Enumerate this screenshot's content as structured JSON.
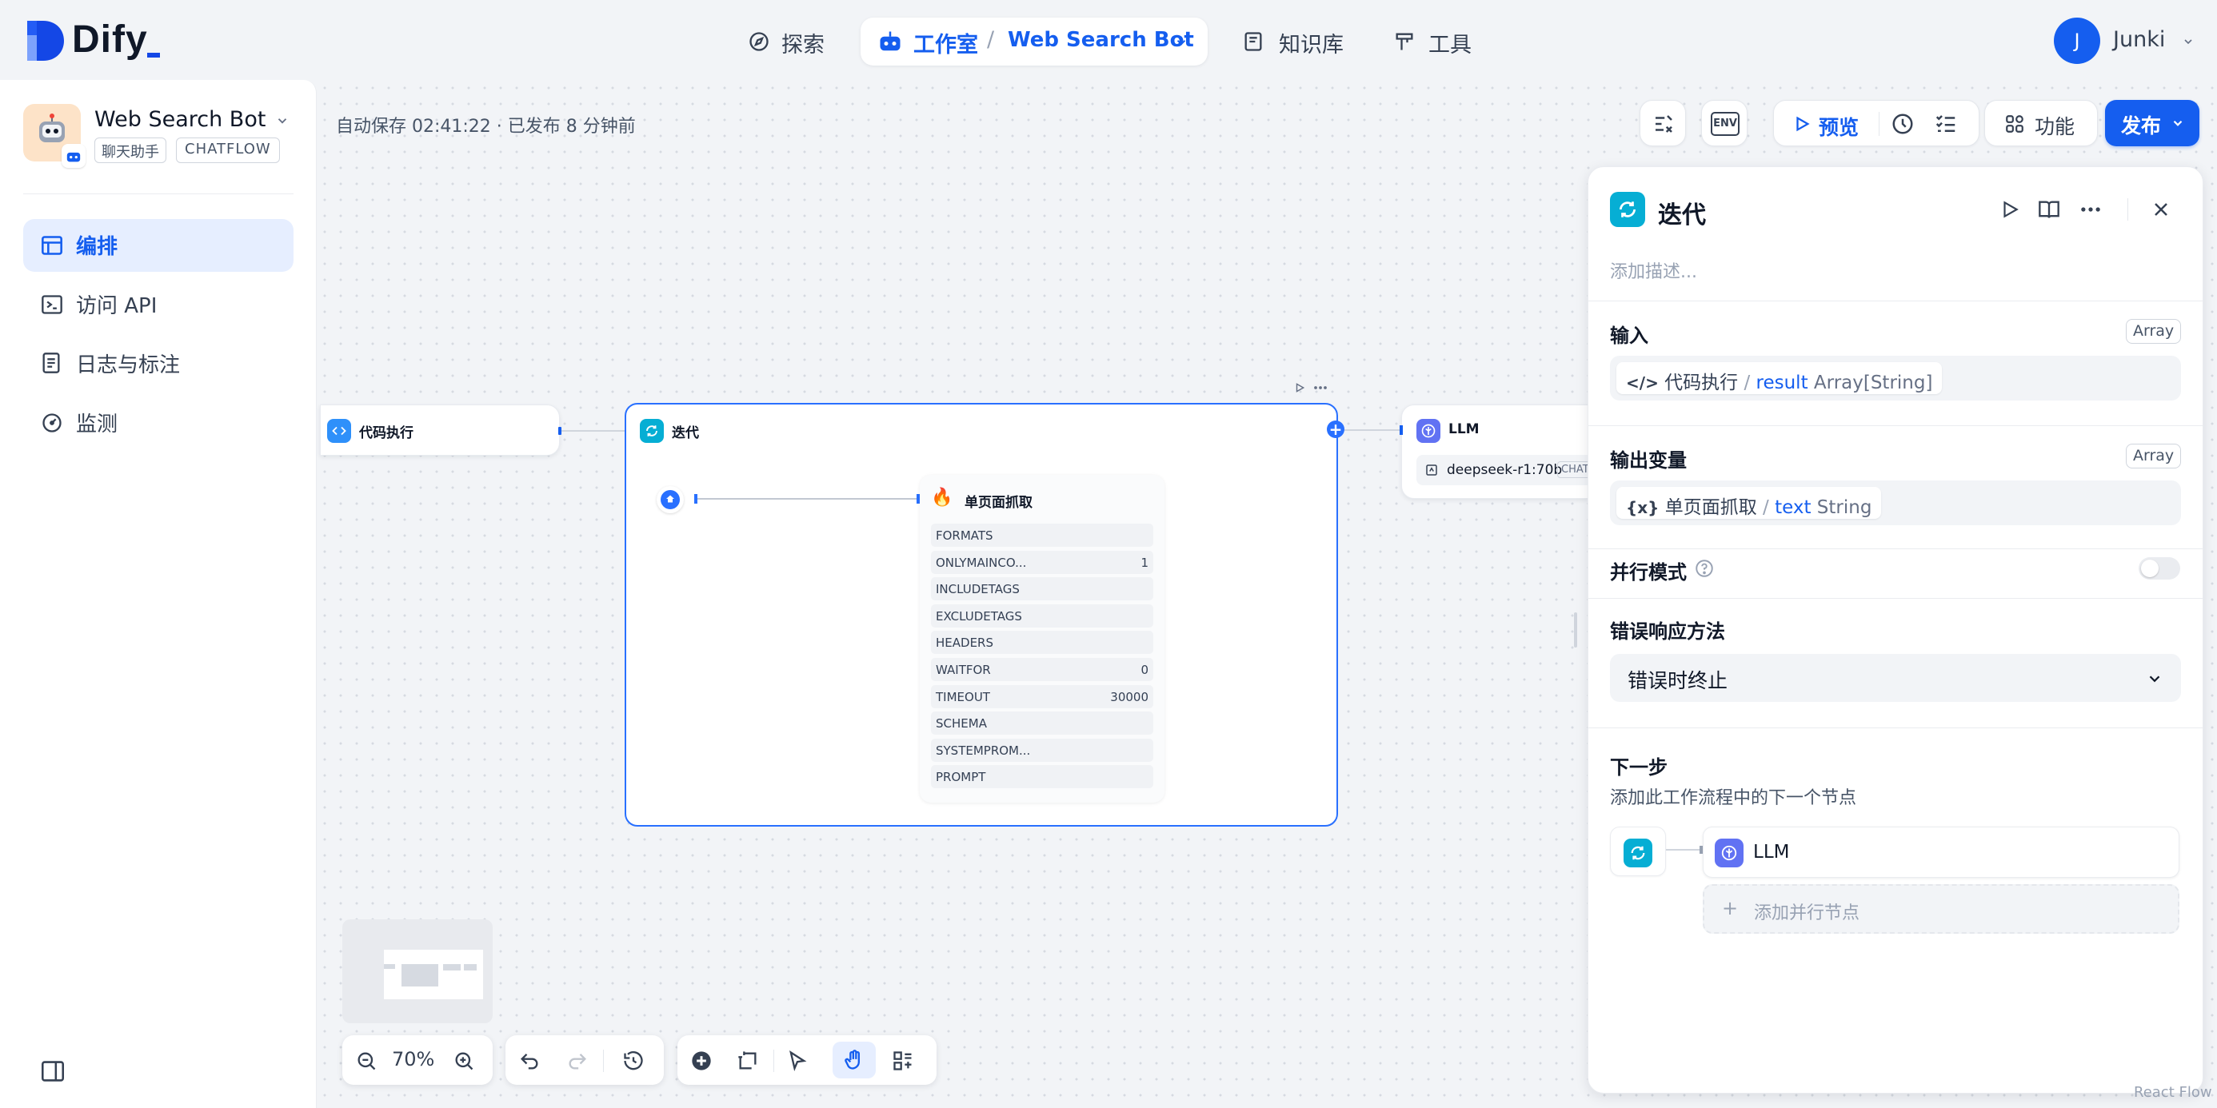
{
  "brand": {
    "name": "Dify"
  },
  "topnav": {
    "explore": "探索",
    "studio": "工作室",
    "app_name": "Web Search Bot",
    "knowledge": "知识库",
    "tools": "工具",
    "user_initial": "J",
    "user_name": "Junki"
  },
  "app": {
    "name": "Web Search Bot",
    "mode_label": "聊天助手",
    "type_badge": "CHATFLOW"
  },
  "sidebar": {
    "items": [
      {
        "label": "编排",
        "active": true
      },
      {
        "label": "访问 API"
      },
      {
        "label": "日志与标注"
      },
      {
        "label": "监测"
      }
    ]
  },
  "status": {
    "autosave": "自动保存 02:41:22 · 已发布 8 分钟前"
  },
  "toolbar": {
    "env": "ENV",
    "preview": "预览",
    "features": "功能",
    "publish": "发布"
  },
  "canvas": {
    "code_node": "代码执行",
    "iteration_node": "迭代",
    "llm_node": "LLM",
    "llm_model": "deepseek-r1:70b",
    "llm_model_tag": "CHAT",
    "scrape_node": "单页面抓取",
    "scrape_params": [
      {
        "key": "FORMATS",
        "value": ""
      },
      {
        "key": "ONLYMAINCO...",
        "value": "1"
      },
      {
        "key": "INCLUDETAGS",
        "value": ""
      },
      {
        "key": "EXCLUDETAGS",
        "value": ""
      },
      {
        "key": "HEADERS",
        "value": ""
      },
      {
        "key": "WAITFOR",
        "value": "0"
      },
      {
        "key": "TIMEOUT",
        "value": "30000"
      },
      {
        "key": "SCHEMA",
        "value": ""
      },
      {
        "key": "SYSTEMPROM...",
        "value": ""
      },
      {
        "key": "PROMPT",
        "value": ""
      }
    ]
  },
  "bottom_controls": {
    "zoom": "70%"
  },
  "panel": {
    "title": "迭代",
    "desc_placeholder": "添加描述...",
    "input_label": "输入",
    "input_type": "Array",
    "input_node": "代码执行",
    "input_var": "result",
    "input_var_type": "Array[String]",
    "output_label": "输出变量",
    "output_type": "Array",
    "output_node": "单页面抓取",
    "output_var": "text",
    "output_var_type": "String",
    "parallel_label": "并行模式",
    "parallel_enabled": false,
    "error_label": "错误响应方法",
    "error_value": "错误时终止",
    "next_label": "下一步",
    "next_desc": "添加此工作流程中的下一个节点",
    "next_node": "LLM",
    "add_parallel": "添加并行节点"
  },
  "watermark": "React Flow",
  "colors": {
    "accent": "#155eef",
    "iteration": "#06aed4",
    "llm": "#6172f3",
    "code": "#2e90fa"
  }
}
